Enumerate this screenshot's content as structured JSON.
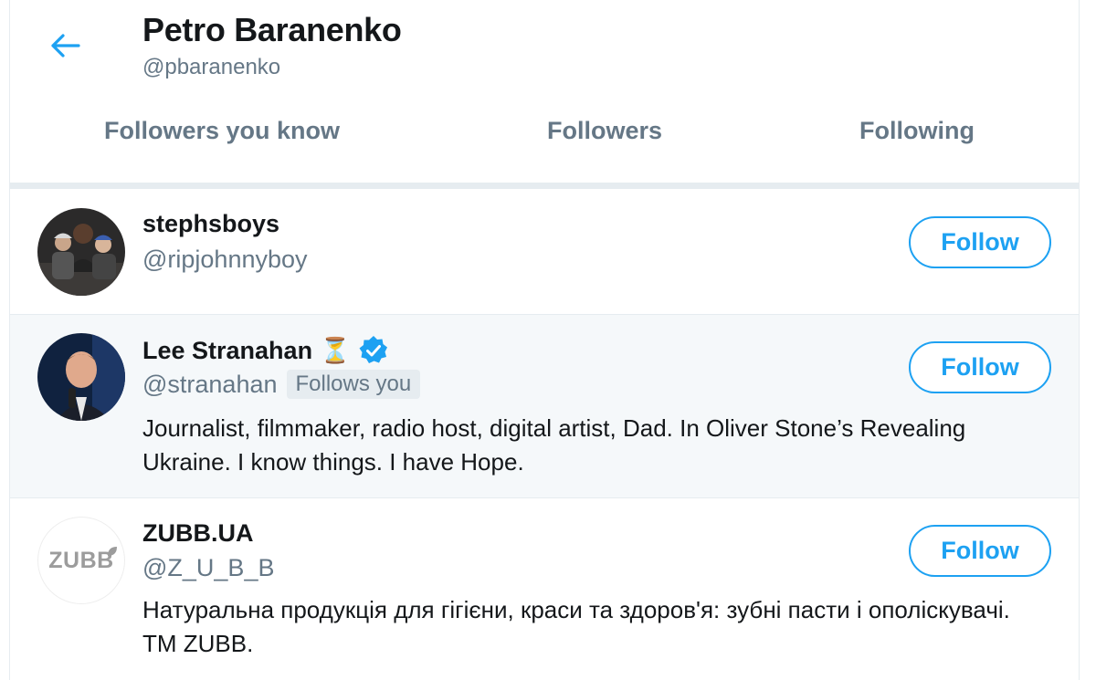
{
  "profile": {
    "name": "Petro Baranenko",
    "handle": "@pbaranenko"
  },
  "tabs": [
    {
      "label": "Followers you know"
    },
    {
      "label": "Followers"
    },
    {
      "label": "Following"
    }
  ],
  "users": [
    {
      "name": "stephsboys",
      "handle": "@ripjohnnyboy",
      "follow_label": "Follow"
    },
    {
      "name": "Lee Stranahan",
      "name_emoji": "⏳",
      "verified": true,
      "handle": "@stranahan",
      "follows_you": "Follows you",
      "bio": "Journalist, filmmaker, radio host, digital artist, Dad. In Oliver Stone’s Revealing Ukraine. I know things. I have Hope.",
      "follow_label": "Follow"
    },
    {
      "name": "ZUBB.UA",
      "handle": "@Z_U_B_B",
      "avatar_text": "ZUBB",
      "bio": "Натуральна продукція для гігієни, краси та здоров'я: зубні пасти і ополіскувачі. ТМ ZUBB.",
      "follow_label": "Follow"
    }
  ],
  "colors": {
    "accent": "#1da1f2",
    "secondary_text": "#657786",
    "divider": "#e6ecf0",
    "highlight_row": "#f5f8fa"
  }
}
